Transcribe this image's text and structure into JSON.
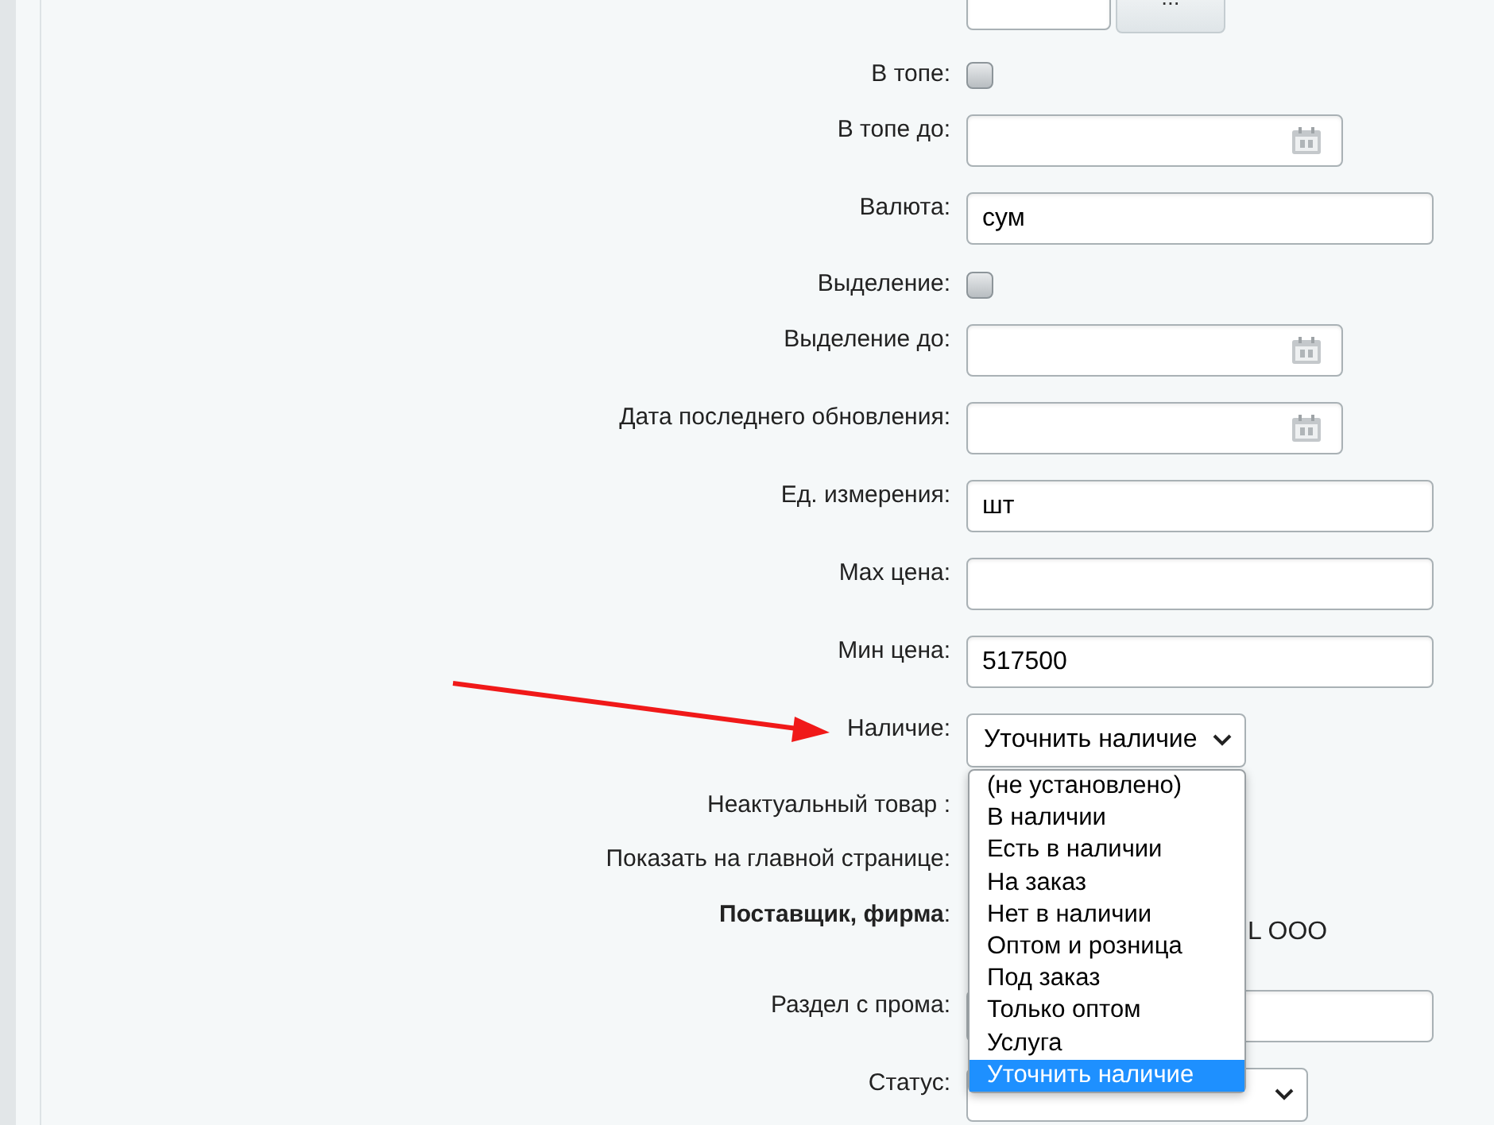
{
  "form": {
    "rows": [
      {
        "kind": "ellipsis",
        "button": "..."
      },
      {
        "kind": "checkbox",
        "label": "В топе:",
        "checked": false
      },
      {
        "kind": "date",
        "label": "В топе до:"
      },
      {
        "kind": "text",
        "label": "Валюта:",
        "value": "сум"
      },
      {
        "kind": "checkbox",
        "label": "Выделение:",
        "checked": false
      },
      {
        "kind": "date",
        "label": "Выделение до:"
      },
      {
        "kind": "date",
        "label": "Дата последнего обновления:"
      },
      {
        "kind": "text",
        "label": "Ед. измерения:",
        "value": "шт"
      },
      {
        "kind": "text",
        "label": "Max цена:"
      },
      {
        "kind": "text",
        "label": "Мин цена:",
        "value": "517500"
      },
      {
        "kind": "select",
        "label": "Наличие:",
        "value": "Уточнить наличие",
        "expanded": true,
        "options": [
          {
            "label": "(не установлено)",
            "selected": false
          },
          {
            "label": "В наличии",
            "selected": false
          },
          {
            "label": "Есть в наличии",
            "selected": false
          },
          {
            "label": "На заказ",
            "selected": false
          },
          {
            "label": "Нет в наличии",
            "selected": false
          },
          {
            "label": "Оптом и розница",
            "selected": false
          },
          {
            "label": "Под заказ",
            "selected": false
          },
          {
            "label": "Только оптом",
            "selected": false
          },
          {
            "label": "Услуга",
            "selected": false
          },
          {
            "label": "Уточнить наличие",
            "selected": true
          }
        ]
      },
      {
        "kind": "hidden",
        "label": "Неактуальный товар :"
      },
      {
        "kind": "hidden",
        "label": "Показать на главной странице:"
      },
      {
        "kind": "static",
        "label": "Поставщик, фирма",
        "label_suffix": ":",
        "value": "L OOO"
      },
      {
        "kind": "text",
        "label": "Раздел с прома:"
      },
      {
        "kind": "select",
        "label": "Статус:",
        "expanded": false
      }
    ]
  }
}
